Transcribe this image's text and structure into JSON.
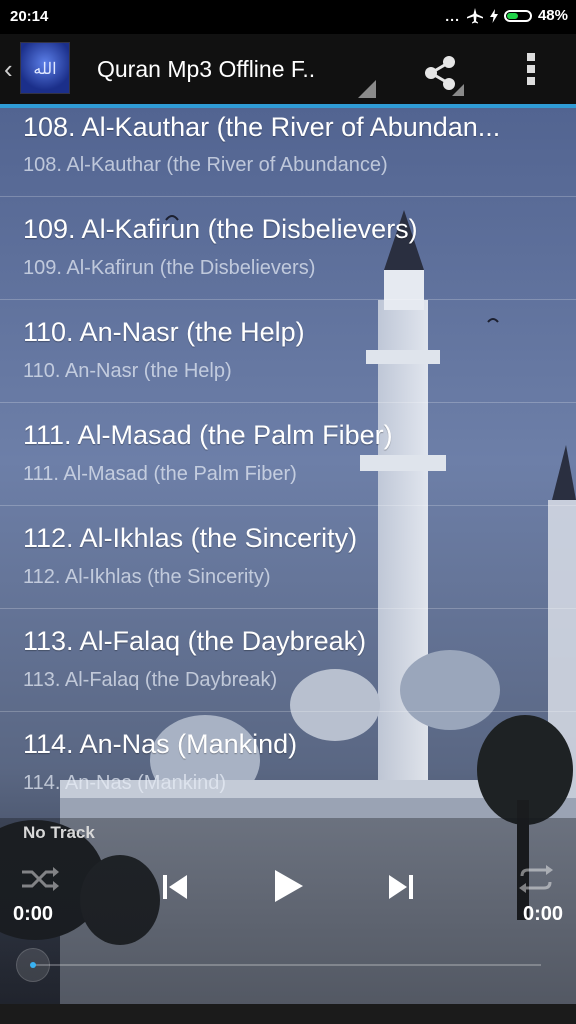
{
  "status_bar": {
    "time": "20:14",
    "dots": "...",
    "battery_percent": "48%",
    "battery_level": 0.48
  },
  "app_bar": {
    "title": "Quran Mp3 Offline F..",
    "icon_text": "الله",
    "accent": "#2f9bd6"
  },
  "tracks": [
    {
      "title": "108. Al-Kauthar (the River of Abundan...",
      "subtitle": "108. Al-Kauthar (the River of Abundance)"
    },
    {
      "title": "109. Al-Kafirun (the Disbelievers)",
      "subtitle": "109. Al-Kafirun (the Disbelievers)"
    },
    {
      "title": "110. An-Nasr (the Help)",
      "subtitle": "110. An-Nasr (the Help)"
    },
    {
      "title": "111. Al-Masad (the Palm Fiber)",
      "subtitle": "111. Al-Masad (the Palm Fiber)"
    },
    {
      "title": "112. Al-Ikhlas (the Sincerity)",
      "subtitle": "112. Al-Ikhlas (the Sincerity)"
    },
    {
      "title": "113. Al-Falaq (the Daybreak)",
      "subtitle": "113. Al-Falaq (the Daybreak)"
    },
    {
      "title": "114. An-Nas (Mankind)",
      "subtitle": "114. An-Nas (Mankind)"
    }
  ],
  "player": {
    "now_playing": "No Track",
    "elapsed": "0:00",
    "duration": "0:00",
    "progress": 0,
    "icons": [
      "shuffle-icon",
      "previous-icon",
      "play-icon",
      "next-icon",
      "repeat-icon"
    ]
  }
}
